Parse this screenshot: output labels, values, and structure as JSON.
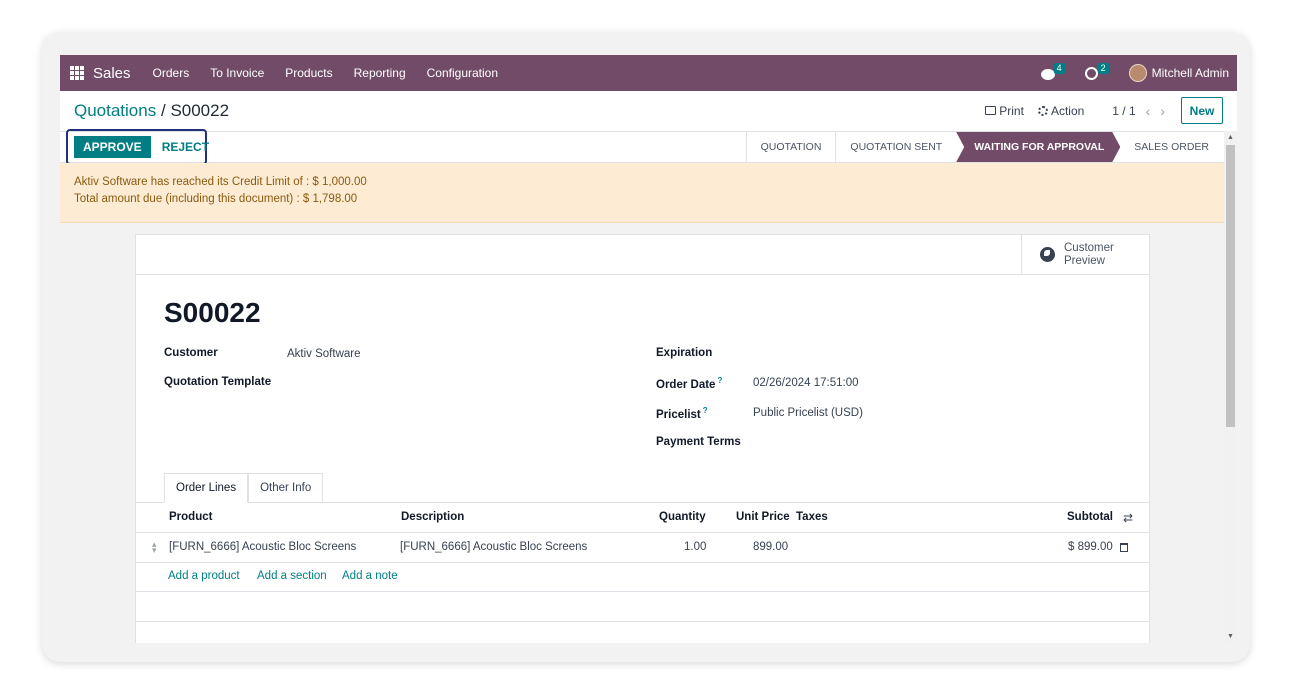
{
  "navbar": {
    "brand": "Sales",
    "items": [
      "Orders",
      "To Invoice",
      "Products",
      "Reporting",
      "Configuration"
    ],
    "chat_badge": "4",
    "activity_badge": "2",
    "user_name": "Mitchell Admin"
  },
  "breadcrumb": {
    "parent": "Quotations",
    "separator": "/",
    "current": "S00022"
  },
  "control": {
    "print_label": "Print",
    "action_label": "Action",
    "pager": "1 / 1",
    "new_label": "New"
  },
  "buttons": {
    "approve": "APPROVE",
    "reject": "REJECT"
  },
  "stages": [
    "QUOTATION",
    "QUOTATION SENT",
    "WAITING FOR APPROVAL",
    "SALES ORDER"
  ],
  "alert": {
    "line1": "Aktiv Software has reached its Credit Limit of : $ 1,000.00",
    "line2": "Total amount due (including this document) : $ 1,798.00"
  },
  "sheet": {
    "customer_preview_1": "Customer",
    "customer_preview_2": "Preview",
    "title": "S00022",
    "fields": {
      "customer_label": "Customer",
      "customer_value": "Aktiv Software",
      "template_label": "Quotation Template",
      "expiration_label": "Expiration",
      "order_date_label": "Order Date",
      "order_date_value": "02/26/2024 17:51:00",
      "pricelist_label": "Pricelist",
      "pricelist_value": "Public Pricelist (USD)",
      "payment_terms_label": "Payment Terms",
      "help_mark": "?"
    },
    "tabs": [
      "Order Lines",
      "Other Info"
    ],
    "columns": [
      "Product",
      "Description",
      "Quantity",
      "Unit Price",
      "Taxes",
      "Subtotal"
    ],
    "rows": [
      {
        "product": "[FURN_6666] Acoustic Bloc Screens",
        "description": "[FURN_6666] Acoustic Bloc Screens",
        "quantity": "1.00",
        "unit_price": "899.00",
        "taxes": "",
        "subtotal": "$ 899.00"
      }
    ],
    "add_links": [
      "Add a product",
      "Add a section",
      "Add a note"
    ]
  }
}
